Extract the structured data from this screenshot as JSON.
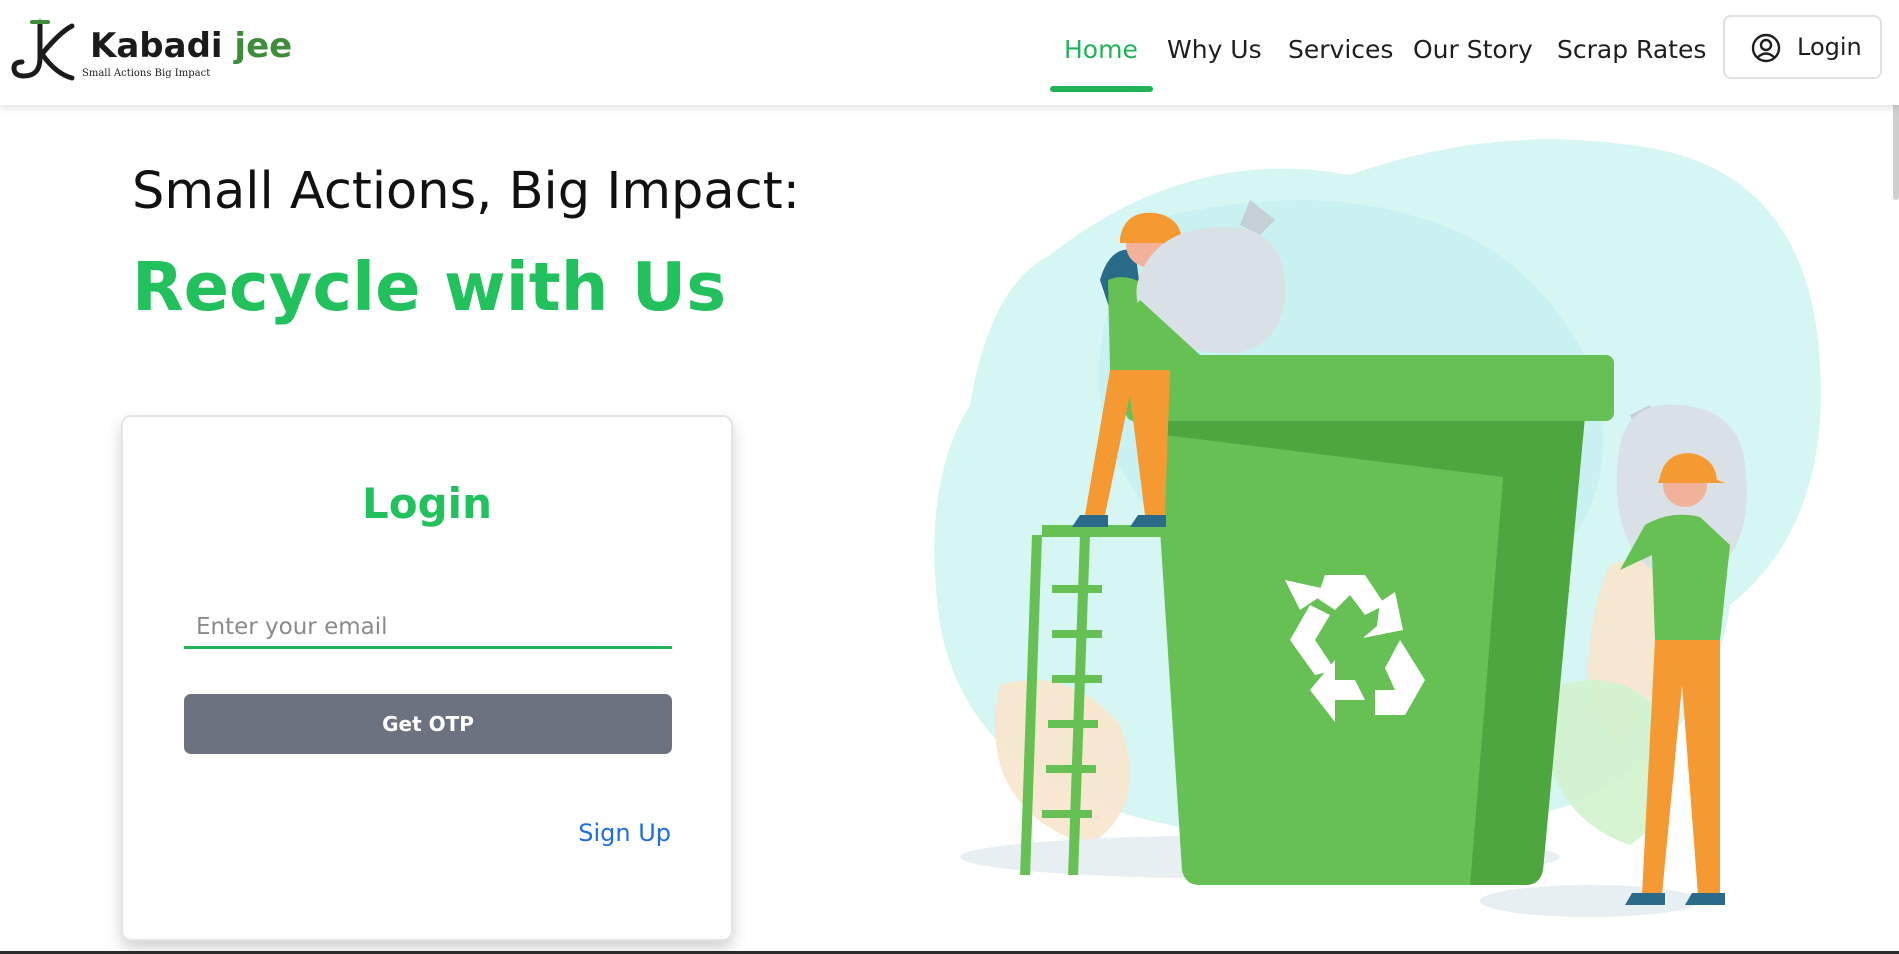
{
  "brand": {
    "name_part1": "Kabadi",
    "name_part2": "jee",
    "tagline": "Small Actions Big Impact",
    "accent_color": "#3f8d3a"
  },
  "nav": {
    "items": [
      {
        "label": "Home",
        "active": true
      },
      {
        "label": "Why Us",
        "active": false
      },
      {
        "label": "Services",
        "active": false
      },
      {
        "label": "Our Story",
        "active": false
      },
      {
        "label": "Scrap Rates",
        "active": false
      }
    ],
    "login_label": "Login",
    "login_icon": "user-circle-icon",
    "active_color": "#22b35a"
  },
  "hero": {
    "line1": "Small Actions, Big Impact:",
    "line2": "Recycle with Us",
    "highlight_color": "#22c15e"
  },
  "login_card": {
    "title": "Login",
    "email_placeholder": "Enter your email",
    "email_value": "",
    "otp_button": "Get OTP",
    "signup_link": "Sign Up",
    "button_color": "#6c7280",
    "link_color": "#1f6fe0"
  },
  "illustration": {
    "subject": "recycling-bin-with-workers",
    "icon": "recycle-icon",
    "bin_color": "#66c054"
  }
}
